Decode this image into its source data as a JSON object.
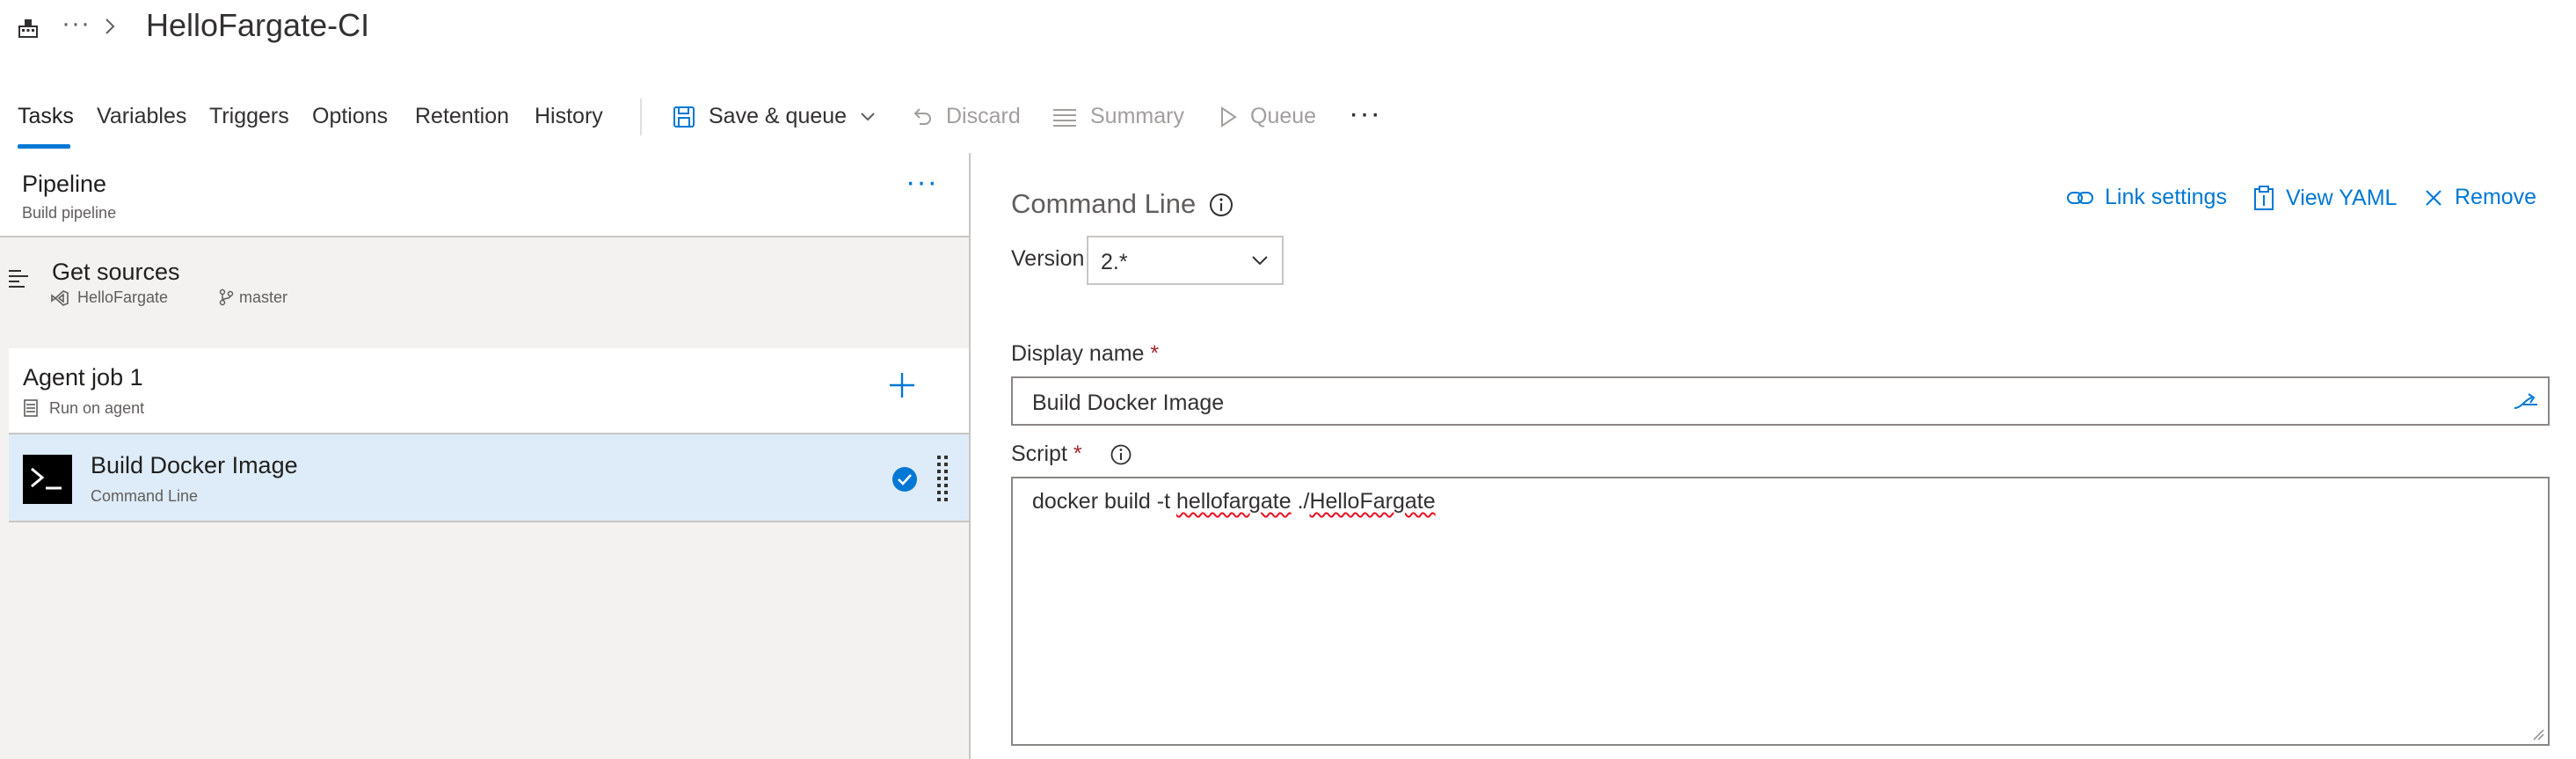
{
  "header": {
    "title": "HelloFargate-CI",
    "more_glyph": "···",
    "icons": {
      "pipeline": "pipeline-icon",
      "breadcrumb": "chevron-right-icon"
    }
  },
  "tabs": [
    {
      "label": "Tasks",
      "active": true
    },
    {
      "label": "Variables"
    },
    {
      "label": "Triggers"
    },
    {
      "label": "Options"
    },
    {
      "label": "Retention"
    },
    {
      "label": "History"
    }
  ],
  "commands": {
    "save_queue": "Save & queue",
    "discard": "Discard",
    "summary": "Summary",
    "queue": "Queue",
    "more_glyph": "···"
  },
  "pipeline": {
    "title": "Pipeline",
    "subtitle": "Build pipeline",
    "more_glyph": "···"
  },
  "sources": {
    "title": "Get sources",
    "repo": "HelloFargate",
    "branch": "master"
  },
  "agent_job": {
    "title": "Agent job 1",
    "subtitle": "Run on agent"
  },
  "task": {
    "title": "Build Docker Image",
    "subtitle": "Command Line"
  },
  "editor": {
    "title": "Command Line",
    "link_settings": "Link settings",
    "view_yaml": "View YAML",
    "remove": "Remove",
    "version_label": "Version",
    "version_value": "2.*",
    "display_name_label": "Display name",
    "display_name_value": "Build Docker Image",
    "script_label": "Script",
    "required_marker": "*",
    "script_parts": [
      "docker build -t ",
      "hellofargate",
      " ./",
      "HelloFargate"
    ]
  },
  "colors": {
    "accent": "#0078d4",
    "selected_bg": "#deecf9",
    "panel_bg": "#f3f2f1",
    "required": "#a4262c"
  }
}
